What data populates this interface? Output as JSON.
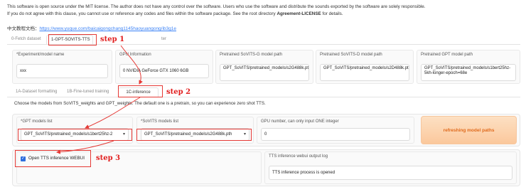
{
  "notice": {
    "line1": "This software is open source under the MIT license. The author does not have any control over the software. Users who use the software and distribute the sounds exported by the software are solely responsible.",
    "line2_pre": "If you do not agree with this clause, you cannot use or reference any codes and files within the software package. See the root directory ",
    "line2_bold": "Agreement-LICENSE",
    "line2_post": " for details."
  },
  "doc": {
    "label": "中文教程文档：",
    "link": "https://www.yuque.com/baicaigongchang1145haoyuangong/ib3g1e"
  },
  "main_tabs": [
    {
      "label": "0-Fetch dataset"
    },
    {
      "label": "1-GPT-SOVITS-TTS"
    },
    {
      "label": "ter"
    }
  ],
  "top_fields": [
    {
      "label": "*Experiment/model name",
      "value": "xxx"
    },
    {
      "label": "GPU Information",
      "value": "0  NVIDIA GeForce GTX 1060 6GB"
    },
    {
      "label": "Pretrained SoVITS-G model path",
      "value": "GPT_SoVITS/pretrained_models/s2G488k.pth"
    },
    {
      "label": "Pretrained SoVITS-D model path",
      "value": "GPT_SoVITS/pretrained_models/s2D488k.pth"
    },
    {
      "label": "Pretrained GPT model path",
      "value": "GPT_SoVITS/pretrained_models/s1bert25hz-5kh-longer-epoch=68e"
    }
  ],
  "sub_tabs": [
    {
      "label": "1A-Dataset formatting"
    },
    {
      "label": "1B-Fine-tuned training"
    },
    {
      "label": "1C-inference"
    }
  ],
  "inference": {
    "description": "Choose the models from SoVITS_weights and GPT_weights. The default one is a pretrain, so you can experience zero shot TTS.",
    "gpt_label": "*GPT models list",
    "gpt_value": "GPT_SoVITS/pretrained_models/s1bert25hz-2",
    "sovits_label": "*SoVITS models list",
    "sovits_value": "GPT_SoVITS/pretrained_models/s2G488k.pth",
    "gpu_label": "GPU number, can only input ONE integer",
    "gpu_value": "0",
    "refresh_label": "refreshing model paths",
    "webui_label": "Open TTS inference WEBUI",
    "webui_checked": true,
    "log_label": "TTS inference webui output log",
    "log_value": "TTS inference process is opened"
  },
  "annotations": {
    "step1": "step 1",
    "step2": "step 2",
    "step3": "step 3"
  },
  "colors": {
    "accent_red": "#e53935",
    "link_blue": "#3b82f6",
    "checkbox_blue": "#2f6fde",
    "refresh_text": "#e06a1c"
  }
}
